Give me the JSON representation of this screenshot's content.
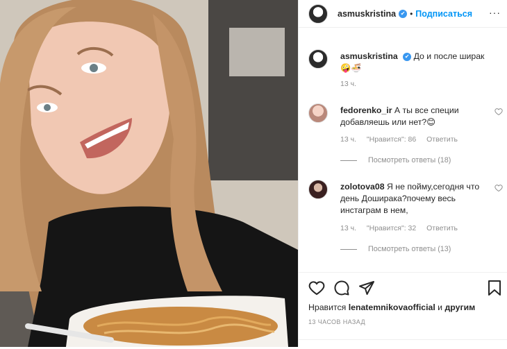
{
  "header": {
    "username": "asmuskristina",
    "verified_mark": "✔",
    "separator": "•",
    "follow_label": "Подписаться",
    "more_label": "···"
  },
  "caption": {
    "username": "asmuskristina",
    "verified_mark": "✔",
    "text": "До и после ширак",
    "emojis": "🤪🍜",
    "time": "13 ч."
  },
  "comments": [
    {
      "username": "fedorenko_ir",
      "text": "А ты все специи добавляешь или нет?😊",
      "time": "13 ч.",
      "likes_label": "\"Нравится\": 86",
      "reply_label": "Ответить",
      "view_replies": "Посмотреть ответы (18)"
    },
    {
      "username": "zolotova08",
      "text": "Я не пойму,сегодня что день Доширака?почему весь инстаграм в нем,",
      "time": "13 ч.",
      "likes_label": "\"Нравится\": 32",
      "reply_label": "Ответить",
      "view_replies": "Посмотреть ответы (13)"
    }
  ],
  "actions": {
    "like_icon": "heart-icon",
    "comment_icon": "comment-icon",
    "share_icon": "share-icon",
    "save_icon": "bookmark-icon"
  },
  "likes": {
    "prefix": "Нравится",
    "user": "lenatemnikovaofficial",
    "suffix": "и",
    "others": "другим"
  },
  "post_time": "13 ЧАСОВ НАЗАД"
}
